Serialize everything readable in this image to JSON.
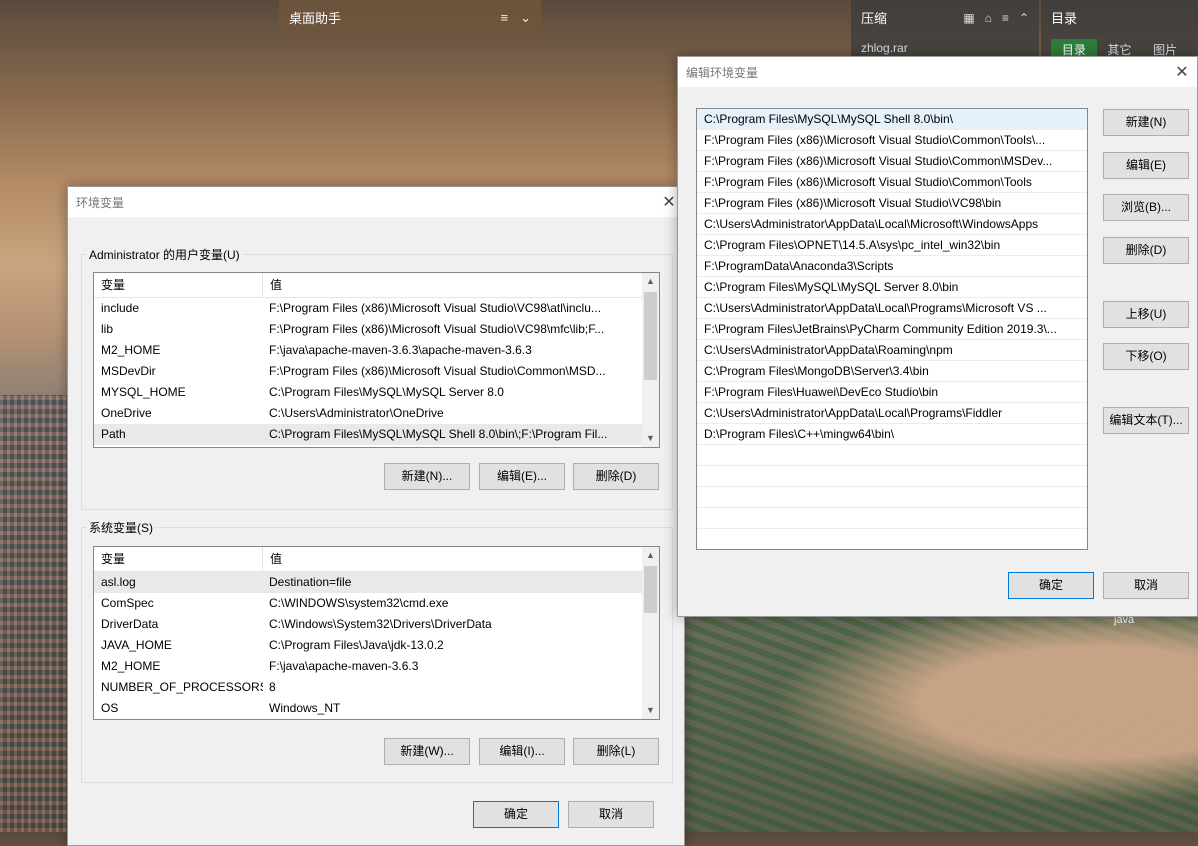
{
  "desktop": {
    "helper_title": "桌面助手",
    "zip_title": "压缩",
    "zip_file": "zhlog.rar",
    "dir_title": "目录",
    "dir_tabs": [
      "目录",
      "其它",
      "图片"
    ],
    "java_label": "java"
  },
  "env_dialog": {
    "title": "环境变量",
    "user_group_label": "Administrator 的用户变量(U)",
    "columns": [
      "变量",
      "值"
    ],
    "user_vars": [
      {
        "name": "include",
        "value": "F:\\Program Files (x86)\\Microsoft Visual Studio\\VC98\\atl\\inclu..."
      },
      {
        "name": "lib",
        "value": "F:\\Program Files (x86)\\Microsoft Visual Studio\\VC98\\mfc\\lib;F..."
      },
      {
        "name": "M2_HOME",
        "value": "F:\\java\\apache-maven-3.6.3\\apache-maven-3.6.3"
      },
      {
        "name": "MSDevDir",
        "value": "F:\\Program Files (x86)\\Microsoft Visual Studio\\Common\\MSD..."
      },
      {
        "name": "MYSQL_HOME",
        "value": "C:\\Program Files\\MySQL\\MySQL Server 8.0"
      },
      {
        "name": "OneDrive",
        "value": "C:\\Users\\Administrator\\OneDrive"
      },
      {
        "name": "Path",
        "value": "C:\\Program Files\\MySQL\\MySQL Shell 8.0\\bin\\;F:\\Program Fil..."
      }
    ],
    "user_buttons": {
      "new": "新建(N)...",
      "edit": "编辑(E)...",
      "delete": "删除(D)"
    },
    "sys_group_label": "系统变量(S)",
    "sys_vars": [
      {
        "name": "asl.log",
        "value": "Destination=file"
      },
      {
        "name": "ComSpec",
        "value": "C:\\WINDOWS\\system32\\cmd.exe"
      },
      {
        "name": "DriverData",
        "value": "C:\\Windows\\System32\\Drivers\\DriverData"
      },
      {
        "name": "JAVA_HOME",
        "value": "C:\\Program Files\\Java\\jdk-13.0.2"
      },
      {
        "name": "M2_HOME",
        "value": "F:\\java\\apache-maven-3.6.3"
      },
      {
        "name": "NUMBER_OF_PROCESSORS",
        "value": "8"
      },
      {
        "name": "OS",
        "value": "Windows_NT"
      }
    ],
    "sys_buttons": {
      "new": "新建(W)...",
      "edit": "编辑(I)...",
      "delete": "删除(L)"
    },
    "ok": "确定",
    "cancel": "取消"
  },
  "edit_dialog": {
    "title": "编辑环境变量",
    "paths": [
      "C:\\Program Files\\MySQL\\MySQL Shell 8.0\\bin\\",
      "F:\\Program Files (x86)\\Microsoft Visual Studio\\Common\\Tools\\...",
      "F:\\Program Files (x86)\\Microsoft Visual Studio\\Common\\MSDev...",
      "F:\\Program Files (x86)\\Microsoft Visual Studio\\Common\\Tools",
      "F:\\Program Files (x86)\\Microsoft Visual Studio\\VC98\\bin",
      "C:\\Users\\Administrator\\AppData\\Local\\Microsoft\\WindowsApps",
      "C:\\Program Files\\OPNET\\14.5.A\\sys\\pc_intel_win32\\bin",
      "F:\\ProgramData\\Anaconda3\\Scripts",
      "C:\\Program Files\\MySQL\\MySQL Server 8.0\\bin",
      "C:\\Users\\Administrator\\AppData\\Local\\Programs\\Microsoft VS ...",
      "F:\\Program Files\\JetBrains\\PyCharm Community Edition 2019.3\\...",
      "C:\\Users\\Administrator\\AppData\\Roaming\\npm",
      "C:\\Program Files\\MongoDB\\Server\\3.4\\bin",
      "F:\\Program Files\\Huawei\\DevEco Studio\\bin",
      "C:\\Users\\Administrator\\AppData\\Local\\Programs\\Fiddler",
      "D:\\Program Files\\C++\\mingw64\\bin\\"
    ],
    "buttons": {
      "new": "新建(N)",
      "edit": "编辑(E)",
      "browse": "浏览(B)...",
      "delete": "删除(D)",
      "up": "上移(U)",
      "down": "下移(O)",
      "edit_text": "编辑文本(T)..."
    },
    "ok": "确定",
    "cancel": "取消"
  }
}
